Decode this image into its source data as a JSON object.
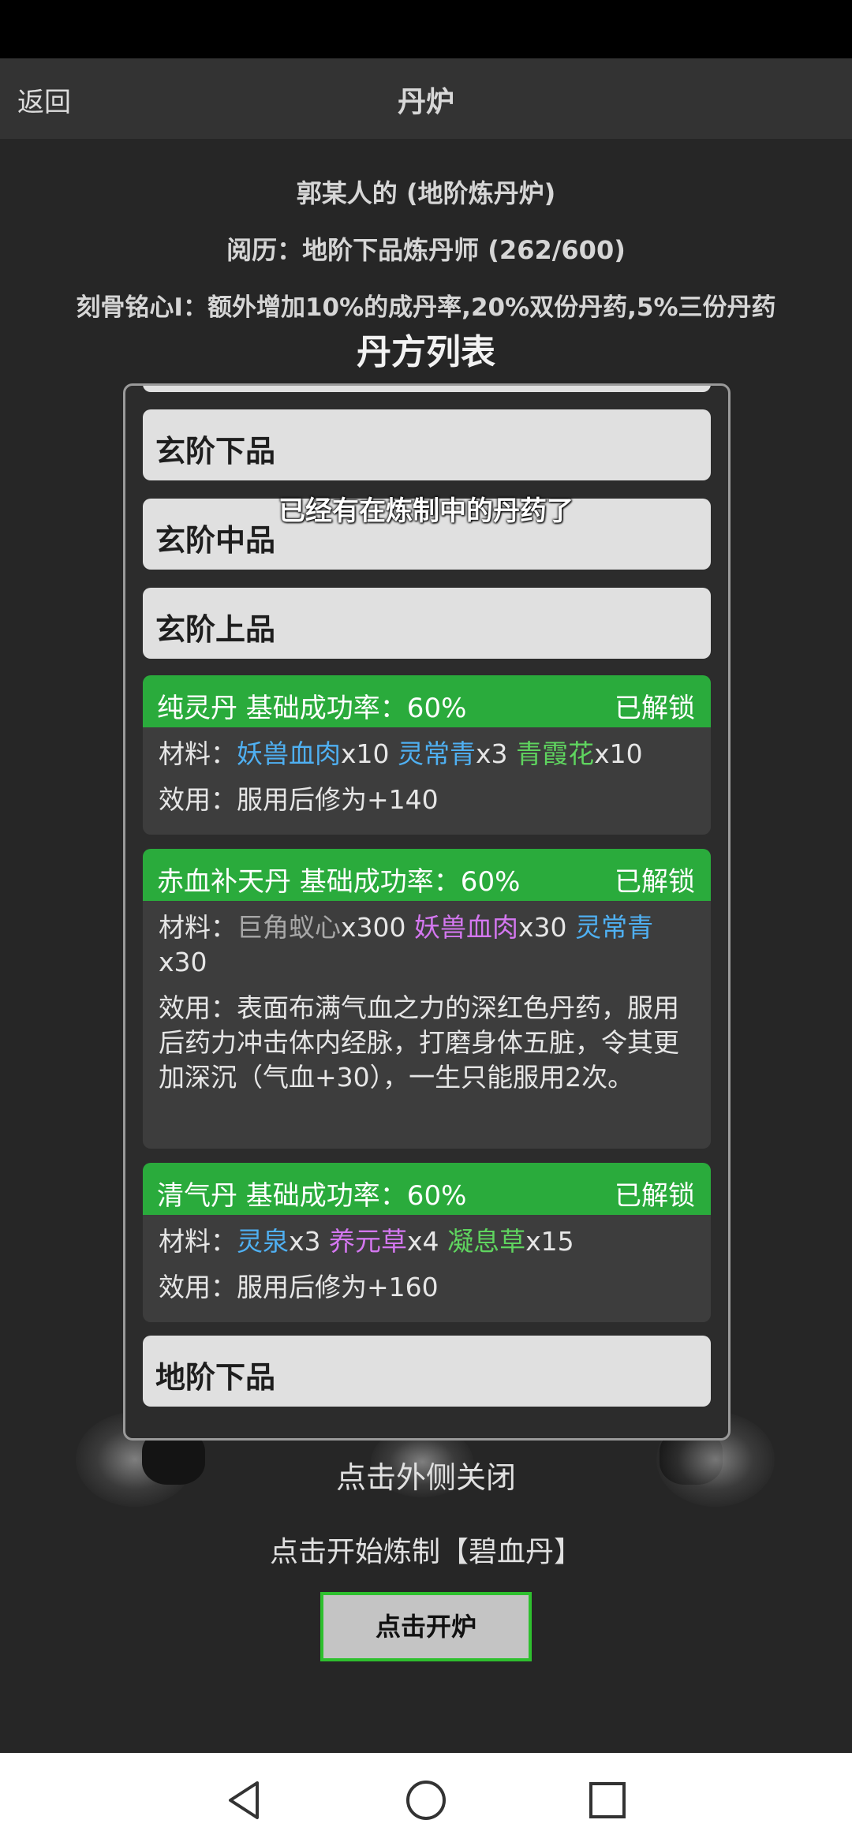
{
  "header": {
    "back_label": "返回",
    "title": "丹炉"
  },
  "info": {
    "furnace": "郭某人的 (地阶炼丹炉)",
    "experience": "阅历：地阶下品炼丹师 (262/600)",
    "bonus": "刻骨铭心I：额外增加10%的成丹率,20%双份丹药,5%三份丹药"
  },
  "modal": {
    "list_title": "丹方列表",
    "grades": [
      "玄阶下品",
      "玄阶中品",
      "玄阶上品",
      "地阶下品"
    ],
    "material_prefix": "材料：",
    "recipes": [
      {
        "title": "纯灵丹 基础成功率：60%",
        "status": "已解锁",
        "materials": [
          {
            "name": "妖兽血肉",
            "qty": "x10",
            "color": "#4fb0f2"
          },
          {
            "name": "灵常青",
            "qty": "x3",
            "color": "#4fb0f2"
          },
          {
            "name": "青霞花",
            "qty": "x10",
            "color": "#5fd45f"
          }
        ],
        "effect": "效用：服用后修为+140"
      },
      {
        "title": "赤血补天丹 基础成功率：60%",
        "status": "已解锁",
        "materials": [
          {
            "name": "巨角蚁心",
            "qty": "x300",
            "color": "#a8a8a8"
          },
          {
            "name": "妖兽血肉",
            "qty": "x30",
            "color": "#d477f0"
          },
          {
            "name": "灵常青",
            "qty": "x30",
            "color": "#4fb0f2"
          }
        ],
        "effect": "效用：表面布满气血之力的深红色丹药，服用后药力冲击体内经脉，打磨身体五脏，令其更加深沉（气血+30），一生只能服用2次。"
      },
      {
        "title": "清气丹 基础成功率：60%",
        "status": "已解锁",
        "materials": [
          {
            "name": "灵泉",
            "qty": "x3",
            "color": "#4fb0f2"
          },
          {
            "name": "养元草",
            "qty": "x4",
            "color": "#d477f0"
          },
          {
            "name": "凝息草",
            "qty": "x15",
            "color": "#5fd45f"
          }
        ],
        "effect": "效用：服用后修为+160"
      }
    ]
  },
  "toast": "已经有在炼制中的丹药了",
  "footer": {
    "close_hint": "点击外侧关闭",
    "start_hint": "点击开始炼制【碧血丹】",
    "open_button": "点击开炉"
  },
  "icons": {
    "back": "nav-back-icon",
    "home": "nav-home-icon",
    "recent": "nav-recent-icon"
  }
}
